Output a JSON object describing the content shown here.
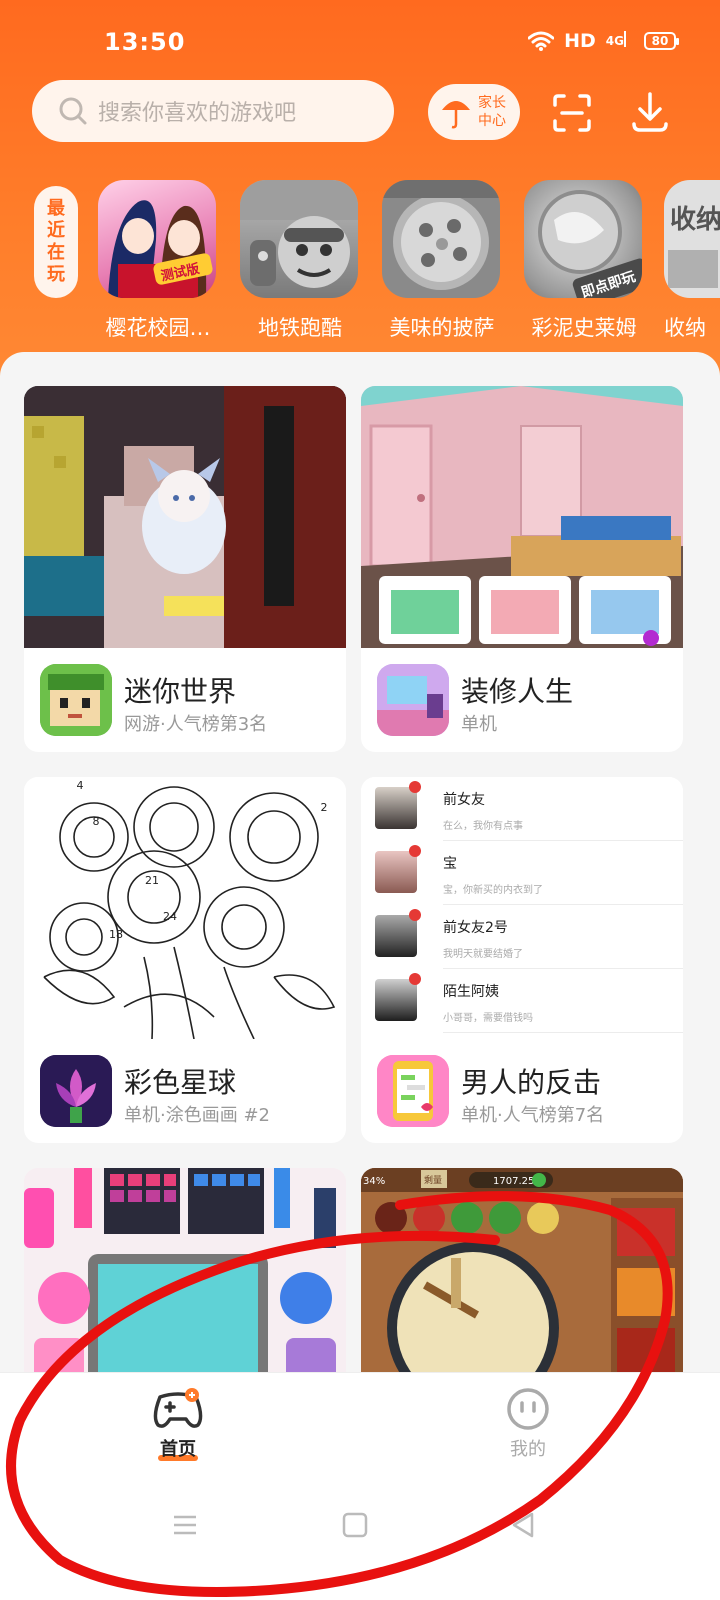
{
  "status": {
    "time": "13:50",
    "hd": "HD",
    "network": "4G",
    "battery": "80"
  },
  "header": {
    "search_placeholder": "搜索你喜欢的游戏吧",
    "parent_center": "家长中心",
    "recent_label": "最近在玩"
  },
  "recent": [
    {
      "name": "樱花校园…",
      "badge": "测试版"
    },
    {
      "name": "地铁跑酷"
    },
    {
      "name": "美味的披萨"
    },
    {
      "name": "彩泥史莱姆",
      "badge": "即点即玩"
    },
    {
      "name": "收纳",
      "badge": "收纳"
    }
  ],
  "games": [
    {
      "title": "迷你世界",
      "sub": "网游·人气榜第3名"
    },
    {
      "title": "装修人生",
      "sub": "单机"
    },
    {
      "title": "彩色星球",
      "sub": "单机·涂色画画 #2"
    },
    {
      "title": "男人的反击",
      "sub": "单机·人气榜第7名"
    }
  ],
  "coloring_numbers": [
    "4",
    "8",
    "2",
    "21",
    "24",
    "18"
  ],
  "chat_preview": [
    {
      "name": "前女友",
      "msg": "在么，我你有点事"
    },
    {
      "name": "宝",
      "msg": "宝，你新买的内衣到了"
    },
    {
      "name": "前女友2号",
      "msg": "我明天就要结婚了"
    },
    {
      "name": "陌生阿姨",
      "msg": "小哥哥，需要借钱吗"
    }
  ],
  "pizza_game": {
    "score": "1707.25",
    "percent": "34%",
    "tab": "剩量"
  },
  "nav": {
    "home": "首页",
    "mine": "我的"
  },
  "colors": {
    "accent": "#ff6b1f",
    "header_gradient_top": "#ff6a1f",
    "overlay_stroke": "#e8110f"
  }
}
